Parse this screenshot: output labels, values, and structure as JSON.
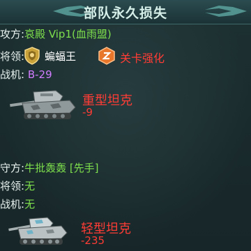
{
  "header": {
    "title": "部队永久损失"
  },
  "attacker": {
    "label": "攻方:",
    "name": "哀殿 Vip1(血雨盟)",
    "general_label": "将领:",
    "general_name": "蝙蝠王",
    "stage_text": "关卡强化",
    "plane_label": "战机:",
    "plane_value": "B-29",
    "loss": {
      "unit": "重型坦克",
      "count": "-9"
    }
  },
  "defender": {
    "label": "守方:",
    "name": "牛批轰轰 [先手]",
    "general_label": "将领:",
    "general_value": "无",
    "plane_label": "战机:",
    "plane_value": "无",
    "loss": {
      "unit": "轻型坦克",
      "count": "-235"
    }
  },
  "colors": {
    "green": "#7ee04c",
    "red": "#ff3c35",
    "purple": "#d17dff",
    "header_bg": "#2b4c50"
  },
  "icons": [
    "wing-ornament-icon",
    "gold-shield-medal-icon",
    "orange-hexagon-emblem-icon",
    "heavy-tank-icon",
    "light-tank-icon"
  ]
}
